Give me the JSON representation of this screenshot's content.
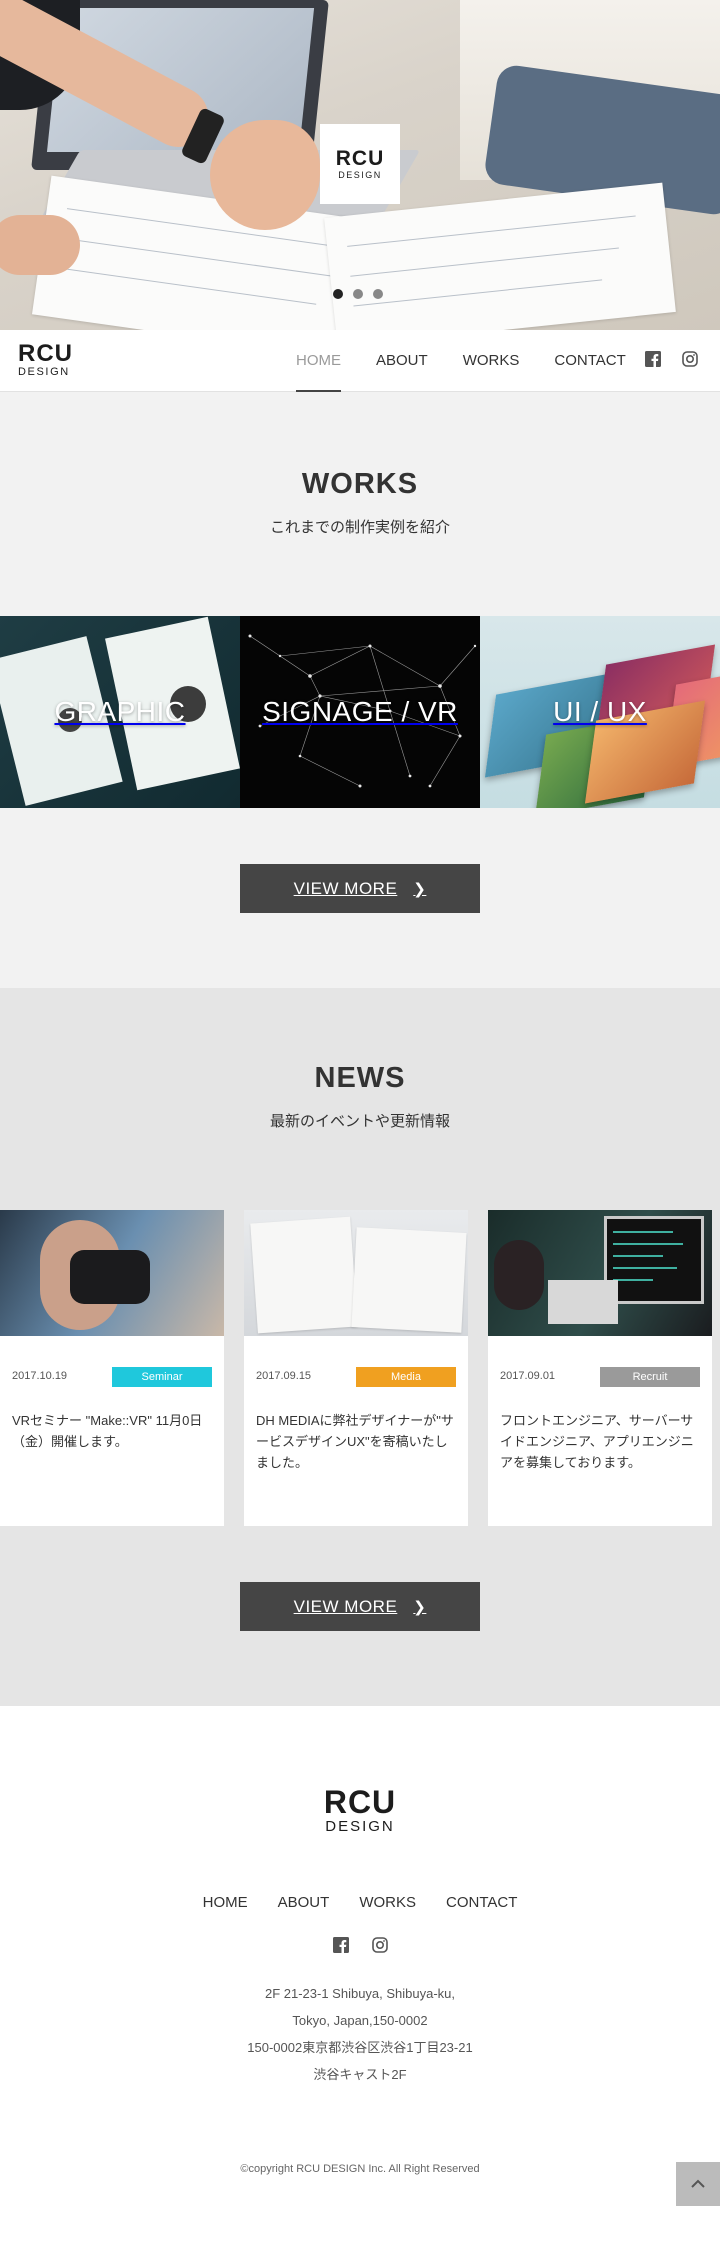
{
  "hero": {
    "logo_line1": "RCU",
    "logo_line2": "DESIGN",
    "slides": 3,
    "active_slide": 1
  },
  "header": {
    "logo_line1": "RCU",
    "logo_line2": "DESIGN",
    "nav": [
      {
        "label": "HOME",
        "active": true
      },
      {
        "label": "ABOUT"
      },
      {
        "label": "WORKS"
      },
      {
        "label": "CONTACT"
      }
    ],
    "social": [
      "facebook-icon",
      "instagram-icon"
    ]
  },
  "works": {
    "title": "WORKS",
    "subtitle": "これまでの制作実例を紹介",
    "tiles": [
      {
        "label": "GRAPHIC"
      },
      {
        "label": "SIGNAGE / VR"
      },
      {
        "label": "UI / UX"
      }
    ],
    "button_label": "VIEW MORE"
  },
  "news": {
    "title": "NEWS",
    "subtitle": "最新のイベントや更新情報",
    "items": [
      {
        "date": "2017.10.19",
        "category": "Seminar",
        "category_color": "#1fc8dc",
        "text": "VRセミナー \"Make::VR\" 11月0日（金）開催します。"
      },
      {
        "date": "2017.09.15",
        "category": "Media",
        "category_color": "#f0a020",
        "text": "DH MEDIAに弊社デザイナーが\"サービスデザインUX\"を寄稿いたしました。"
      },
      {
        "date": "2017.09.01",
        "category": "Recruit",
        "category_color": "#9a9a9a",
        "text": "フロントエンジニア、サーバーサイドエンジニア、アプリエンジニアを募集しております。"
      }
    ],
    "button_label": "VIEW MORE"
  },
  "footer": {
    "logo_line1": "RCU",
    "logo_line2": "DESIGN",
    "nav": [
      "HOME",
      "ABOUT",
      "WORKS",
      "CONTACT"
    ],
    "address": [
      "2F 21-23-1 Shibuya, Shibuya-ku,",
      "Tokyo, Japan,150-0002",
      "150-0002東京都渋谷区渋谷1丁目23-21",
      "渋谷キャスト2F"
    ],
    "copyright": "©copyright RCU DESIGN Inc. All Right Reserved"
  }
}
